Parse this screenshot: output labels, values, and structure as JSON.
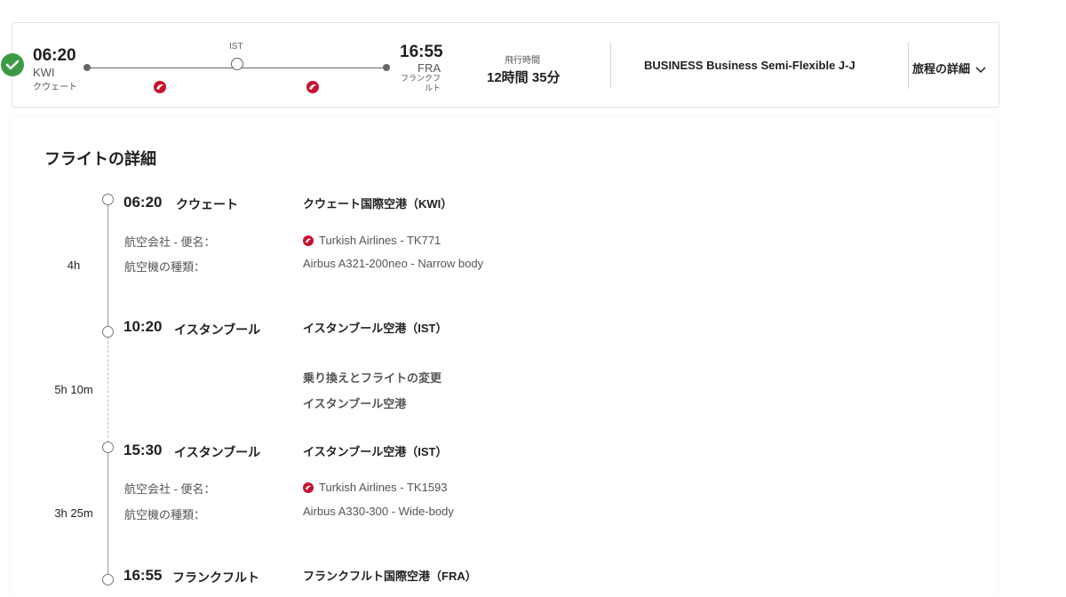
{
  "summary": {
    "departure": {
      "time": "06:20",
      "code": "KWI",
      "city": "クウェート"
    },
    "stop": {
      "code": "IST"
    },
    "arrival": {
      "time": "16:55",
      "code": "FRA",
      "city": "フランクフルト"
    },
    "duration_label": "飛行時間",
    "duration_value": "12時間 35分",
    "fare": "BUSINESS Business Semi-Flexible J-J",
    "details_link": "旅程の詳細"
  },
  "details": {
    "title": "フライトの詳細",
    "events": [
      {
        "time": "06:20",
        "city": "クウェート",
        "airport": "クウェート国際空港（KWI）"
      },
      {
        "time": "10:20",
        "city": "イスタンブール",
        "airport": "イスタンブール空港（IST）"
      },
      {
        "time": "15:30",
        "city": "イスタンブール",
        "airport": "イスタンブール空港（IST）"
      },
      {
        "time": "16:55",
        "city": "フランクフルト",
        "airport": "フランクフルト国際空港（FRA）"
      }
    ],
    "segments": [
      {
        "duration": "4h",
        "airline_label": "航空会社 - 便名：",
        "airline_value": "Turkish Airlines - TK771",
        "aircraft_label": "航空機の種類：",
        "aircraft_value": "Airbus A321-200neo - Narrow body"
      },
      {
        "duration": "3h 25m",
        "airline_label": "航空会社 - 便名：",
        "airline_value": "Turkish Airlines - TK1593",
        "aircraft_label": "航空機の種類：",
        "aircraft_value": "Airbus A330-300 - Wide-body"
      }
    ],
    "layover": {
      "duration": "5h 10m",
      "title": "乗り換えとフライトの変更",
      "location": "イスタンブール空港"
    }
  },
  "colors": {
    "check": "#3c9a45",
    "airline_red": "#c8102e"
  }
}
